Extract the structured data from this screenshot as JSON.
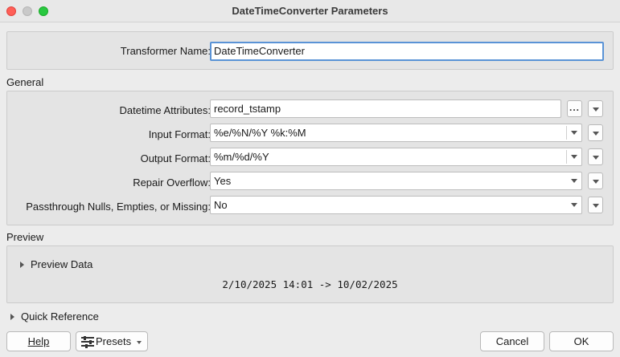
{
  "window": {
    "title": "DateTimeConverter Parameters"
  },
  "transformer": {
    "label": "Transformer Name:",
    "value": "DateTimeConverter"
  },
  "general": {
    "section_label": "General",
    "datetime_attributes": {
      "label": "Datetime Attributes:",
      "value": "record_tstamp",
      "more_button": "..."
    },
    "input_format": {
      "label": "Input Format:",
      "value": "%e/%N/%Y %k:%M"
    },
    "output_format": {
      "label": "Output Format:",
      "value": "%m/%d/%Y"
    },
    "repair_overflow": {
      "label": "Repair Overflow:",
      "value": "Yes"
    },
    "passthrough": {
      "label": "Passthrough Nulls, Empties, or Missing:",
      "value": "No"
    }
  },
  "preview": {
    "section_label": "Preview",
    "toggle_label": "Preview Data",
    "result": "2/10/2025 14:01 -> 10/02/2025"
  },
  "quick_reference": {
    "label": "Quick Reference"
  },
  "buttons": {
    "help": "Help",
    "presets": "Presets",
    "cancel": "Cancel",
    "ok": "OK"
  },
  "colors": {
    "focus_border": "#5a93d6",
    "close": "#ff5f57",
    "maximize": "#28c840"
  }
}
